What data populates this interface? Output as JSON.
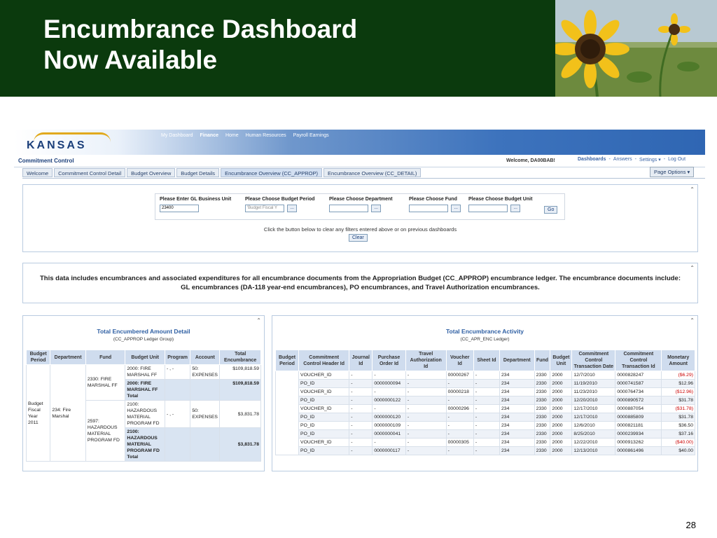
{
  "slide": {
    "title_line1": "Encumbrance Dashboard",
    "title_line2": "Now Available",
    "page_number": "28"
  },
  "app": {
    "logo": "KANSAS",
    "topnav": [
      "My Dashboard",
      "Finance",
      "Home",
      "Human Resources",
      "Payroll Earnings"
    ],
    "topnav_active": "Finance",
    "section_title": "Commitment Control",
    "welcome": "Welcome, DA00BAB!",
    "usernav": [
      "Dashboards",
      "-",
      "Answers",
      "-",
      "Settings ▾",
      "-",
      "Log Out"
    ],
    "page_options": "Page Options ▾",
    "tabs": [
      "Welcome",
      "Commitment Control Detail",
      "Budget Overview",
      "Budget Details",
      "Encumbrance Overview (CC_APPROP)",
      "Encumbrance Overview (CC_DETAIL)"
    ],
    "active_tab": "Encumbrance Overview (CC_APPROP)"
  },
  "filters": {
    "business_unit_label": "Please Enter GL Business Unit",
    "business_unit_value": "23400",
    "budget_period_label": "Please Choose Budget Period",
    "budget_period_value": "'Budget Fiscal Y",
    "department_label": "Please Choose Department",
    "fund_label": "Please Choose Fund",
    "budget_unit_label": "Please Choose Budget Unit",
    "browse": "...",
    "go": "Go",
    "clear_text": "Click the button below to clear any filters entered above or on previous dashboards",
    "clear": "Clear"
  },
  "info_text": "This data includes encumbrances and associated expenditures for all encumbrance documents from the Appropriation Budget (CC_APPROP) encumbrance ledger. The encumbrance documents include: GL encumbrances (DA-118 year-end encumbrances), PO encumbrances, and Travel Authorization encumbrances.",
  "left_panel": {
    "title": "Total Encumbered Amount Detail",
    "subtitle": "(CC_APPROP Ledger Group)",
    "headers": [
      "Budget Period",
      "Department",
      "Fund",
      "Budget Unit",
      "Program",
      "Account",
      "Total Encumbrance"
    ],
    "budget_period": "Budget Fiscal Year 2011",
    "department": "234: Fire Marshal",
    "fund1": "2330: FIRE MARSHAL FF",
    "fund2": "2597: HAZARDOUS MATERIAL PROGRAM FD",
    "unit1": "2000: FIRE MARSHAL FF",
    "unit1_total": "2000: FIRE MARSHAL FF Total",
    "unit2": "2100: HAZARDOUS MATERIAL PROGRAM FD",
    "unit2_total": "2100: HAZARDOUS MATERIAL PROGRAM FD Total",
    "program": "- , -",
    "program2": "- , -",
    "account1": "50: EXPENSES",
    "account2": "50: EXPENSES",
    "amount1": "$109,818.59",
    "amount1_total": "$109,818.59",
    "amount2": "$3,831.78",
    "amount2_total": "$3,831.78"
  },
  "right_panel": {
    "title": "Total Encumbrance Activity",
    "subtitle": "(CC_APR_ENC Ledger)",
    "headers": [
      "Budget Period",
      "Commitment Control Header Id",
      "Journal Id",
      "Purchase Order Id",
      "Travel Authorization Id",
      "Voucher Id",
      "Sheet Id",
      "Department",
      "Fund",
      "Budget Unit",
      "Commitment Control Transaction Date",
      "Commitment Control Transaction Id",
      "Monetary Amount"
    ],
    "rows": [
      [
        "VOUCHER_ID",
        "-",
        "-",
        "-",
        "00000267",
        "-",
        "234",
        "2330",
        "2000",
        "12/7/2010",
        "0000828247",
        "($6.29)"
      ],
      [
        "PO_ID",
        "-",
        "0000000094",
        "-",
        "-",
        "-",
        "234",
        "2330",
        "2000",
        "11/19/2010",
        "0000741587",
        "$12.96"
      ],
      [
        "VOUCHER_ID",
        "-",
        "-",
        "-",
        "00000218",
        "-",
        "234",
        "2330",
        "2000",
        "11/23/2010",
        "0000764734",
        "($12.96)"
      ],
      [
        "PO_ID",
        "-",
        "0000000122",
        "-",
        "-",
        "-",
        "234",
        "2330",
        "2000",
        "12/20/2010",
        "0000890572",
        "$31.78"
      ],
      [
        "VOUCHER_ID",
        "-",
        "-",
        "-",
        "00000296",
        "-",
        "234",
        "2330",
        "2000",
        "12/17/2010",
        "0000887054",
        "($31.78)"
      ],
      [
        "PO_ID",
        "-",
        "0000000120",
        "-",
        "-",
        "-",
        "234",
        "2330",
        "2000",
        "12/17/2010",
        "0000885809",
        "$31.78"
      ],
      [
        "PO_ID",
        "-",
        "0000000109",
        "-",
        "-",
        "-",
        "234",
        "2330",
        "2000",
        "12/6/2010",
        "0000821181",
        "$36.50"
      ],
      [
        "PO_ID",
        "-",
        "0000000041",
        "-",
        "-",
        "-",
        "234",
        "2330",
        "2000",
        "8/25/2010",
        "0000239934",
        "$37.16"
      ],
      [
        "VOUCHER_ID",
        "-",
        "-",
        "-",
        "00000305",
        "-",
        "234",
        "2330",
        "2000",
        "12/22/2010",
        "0000913262",
        "($40.00)"
      ],
      [
        "PO_ID",
        "-",
        "0000000117",
        "-",
        "-",
        "-",
        "234",
        "2330",
        "2000",
        "12/13/2010",
        "0000861496",
        "$40.00"
      ]
    ]
  }
}
